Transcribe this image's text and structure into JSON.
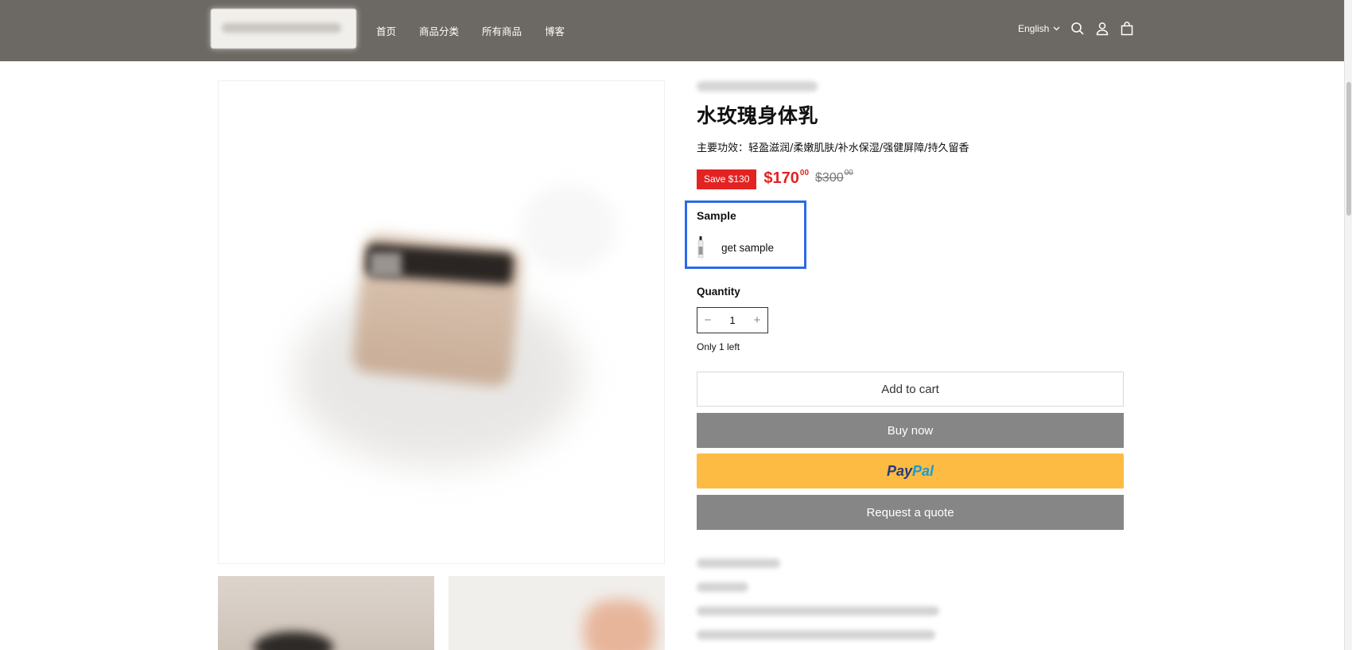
{
  "header": {
    "nav": [
      "首页",
      "商品分类",
      "所有商品",
      "博客"
    ],
    "language": "English",
    "icons": [
      "search-icon",
      "account-icon",
      "cart-icon"
    ],
    "background": "#6c6863"
  },
  "product": {
    "title": "水玫瑰身体乳",
    "subtitle": "主要功效：轻盈滋润/柔嫩肌肤/补水保湿/强健屏障/持久留香",
    "save_badge": "Save $130",
    "price_main": "$170",
    "price_cents": "00",
    "compare_main": "$300",
    "compare_cents": "00",
    "sample": {
      "label": "Sample",
      "option": "get sample"
    },
    "quantity": {
      "label": "Quantity",
      "value": "1",
      "minus": "−",
      "plus": "+"
    },
    "stock_note": "Only 1 left",
    "buttons": {
      "add_to_cart": "Add to cart",
      "buy_now": "Buy now",
      "paypal_a": "Pay",
      "paypal_b": "Pal",
      "request_quote": "Request a quote"
    }
  },
  "colors": {
    "sale_red": "#e32222",
    "highlight_blue": "#2d6ae8",
    "paypal_yellow": "#fdbb43",
    "button_gray": "#868686"
  }
}
